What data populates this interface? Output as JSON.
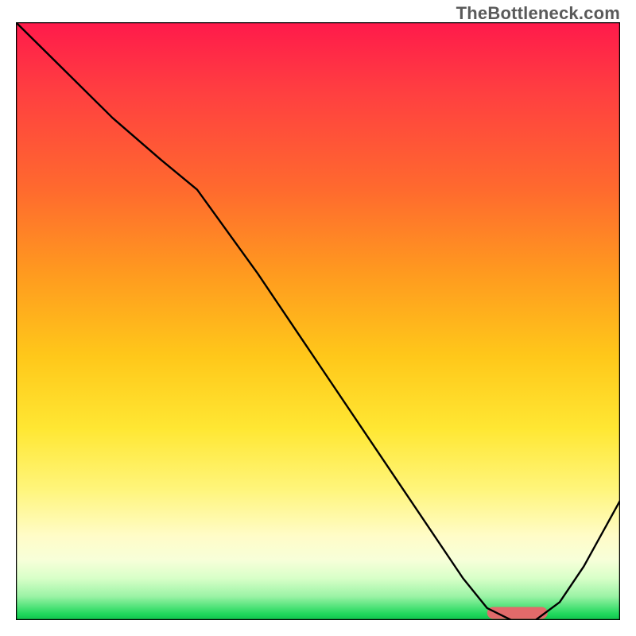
{
  "watermark": "TheBottleneck.com",
  "chart_data": {
    "type": "line",
    "title": "",
    "xlabel": "",
    "ylabel": "",
    "xlim": [
      0,
      100
    ],
    "ylim": [
      0,
      100
    ],
    "series": [
      {
        "name": "curve",
        "color": "#000000",
        "stroke_width": 2.4,
        "x": [
          0,
          8,
          16,
          24,
          30,
          40,
          50,
          60,
          68,
          74,
          78,
          82,
          86,
          90,
          94,
          100
        ],
        "y": [
          100,
          92,
          84,
          77,
          72,
          58,
          43,
          28,
          16,
          7,
          2,
          0,
          0,
          3,
          9,
          20
        ]
      }
    ],
    "marker": {
      "color": "#e26a6a",
      "x_start": 78,
      "x_end": 88,
      "y": 1.2,
      "height": 2.0,
      "rx": 1.0
    },
    "frame": {
      "stroke": "#000000",
      "width": 2.5
    }
  }
}
